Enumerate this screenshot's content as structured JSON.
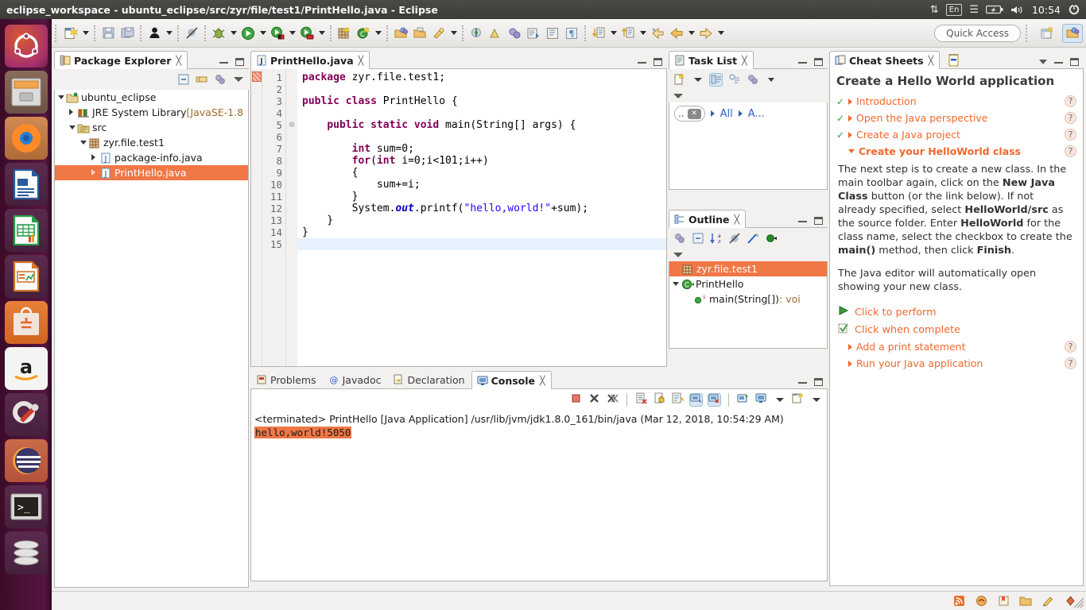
{
  "window": {
    "title": "eclipse_workspace - ubuntu_eclipse/src/zyr/file/test1/PrintHello.java - Eclipse"
  },
  "tray": {
    "network_icon": "network-updown-icon",
    "keyboard_layout": "En",
    "bluetooth_icon": "bluetooth-icon",
    "battery_icon": "battery-icon",
    "volume_icon": "volume-icon",
    "clock": "10:54",
    "session_icon": "session-gear-icon"
  },
  "launcher": {
    "items": [
      {
        "name": "ubuntu-dash",
        "glyph": "●",
        "cls": "ic-ubuntu",
        "active": false,
        "focus": false
      },
      {
        "name": "files",
        "glyph": "▤",
        "cls": "ic-files",
        "active": true,
        "focus": false
      },
      {
        "name": "firefox",
        "glyph": "●",
        "cls": "ic-firefox",
        "active": true,
        "focus": false
      },
      {
        "name": "libreoffice-writer",
        "glyph": "☰",
        "cls": "ic-writer",
        "active": false,
        "focus": false
      },
      {
        "name": "libreoffice-calc",
        "glyph": "⊞",
        "cls": "ic-calc",
        "active": false,
        "focus": false
      },
      {
        "name": "libreoffice-impress",
        "glyph": "▦",
        "cls": "ic-impress",
        "active": false,
        "focus": false
      },
      {
        "name": "ubuntu-software",
        "glyph": "A",
        "cls": "ic-software",
        "active": false,
        "focus": false
      },
      {
        "name": "amazon",
        "glyph": "a",
        "cls": "ic-amazon",
        "active": false,
        "focus": false
      },
      {
        "name": "system-settings",
        "glyph": "⚙",
        "cls": "ic-settings",
        "active": false,
        "focus": false
      },
      {
        "name": "eclipse",
        "glyph": "◐",
        "cls": "ic-eclipse",
        "active": true,
        "focus": true
      },
      {
        "name": "terminal",
        "glyph": "▶_",
        "cls": "ic-terminal",
        "active": false,
        "focus": false
      },
      {
        "name": "trash",
        "glyph": "□",
        "cls": "ic-trash",
        "active": false,
        "focus": false
      }
    ]
  },
  "toolbar": {
    "quick_access_placeholder": "Quick Access",
    "items": [
      {
        "name": "new-wizard-button",
        "glyph": "new",
        "arrow": true
      },
      {
        "sep": true
      },
      {
        "name": "save-button",
        "glyph": "save",
        "arrow": false
      },
      {
        "name": "save-all-button",
        "glyph": "saveall",
        "arrow": false
      },
      {
        "sep": true
      },
      {
        "name": "toggle-user-button",
        "glyph": "user",
        "arrow": true
      },
      {
        "sep": true
      },
      {
        "name": "skip-breakpoints-button",
        "glyph": "skipbp",
        "arrow": false
      },
      {
        "sep": true
      },
      {
        "name": "debug-button",
        "glyph": "debug",
        "arrow": true
      },
      {
        "name": "run-button",
        "glyph": "run",
        "arrow": true
      },
      {
        "name": "coverage-button",
        "glyph": "coverage",
        "arrow": true
      },
      {
        "name": "run-external-tools-button",
        "glyph": "externaltools",
        "arrow": true
      },
      {
        "sep": true
      },
      {
        "name": "new-java-package-button",
        "glyph": "newpackage",
        "arrow": false
      },
      {
        "name": "new-java-class-button",
        "glyph": "newclass",
        "arrow": true
      },
      {
        "sep": true
      },
      {
        "name": "open-type-button",
        "glyph": "opentype",
        "arrow": false
      },
      {
        "name": "open-task-button",
        "glyph": "opentask",
        "arrow": false
      },
      {
        "name": "search-button",
        "glyph": "search",
        "arrow": false
      },
      {
        "name": "annotation-button",
        "glyph": "annotation",
        "arrow": true
      },
      {
        "sep": true
      },
      {
        "name": "new-task-button",
        "glyph": "newtask",
        "arrow": false
      },
      {
        "name": "mark-done-button",
        "glyph": "markdone",
        "arrow": false
      },
      {
        "name": "activate-task-button",
        "glyph": "activatetask",
        "arrow": false
      },
      {
        "name": "previous-edit-button",
        "glyph": "prevedit",
        "arrow": false
      },
      {
        "name": "show-whitespace-button",
        "glyph": "whitespace",
        "arrow": false
      },
      {
        "sep": true
      },
      {
        "name": "next-annotation-button",
        "glyph": "nextanno",
        "arrow": true
      },
      {
        "name": "previous-annotation-button",
        "glyph": "prevanno",
        "arrow": true
      },
      {
        "name": "last-edit-location-button",
        "glyph": "lastedit",
        "arrow": false
      },
      {
        "name": "back-button",
        "glyph": "back",
        "arrow": true
      },
      {
        "name": "forward-button",
        "glyph": "forward",
        "arrow": true
      }
    ],
    "perspective_new": "open-perspective-button",
    "perspective_java": "java-perspective-button"
  },
  "package_explorer": {
    "tab_label": "Package Explorer",
    "tab_icon": "package-explorer-icon",
    "toolbar": [
      {
        "name": "collapse-all-button",
        "icon": "collapse-all-icon"
      },
      {
        "name": "link-with-editor-button",
        "icon": "link-editor-icon"
      },
      {
        "name": "view-menu-filters-button",
        "icon": "filters-icon"
      },
      {
        "name": "view-menu-button",
        "icon": "chevron-down-icon"
      }
    ],
    "tree": [
      {
        "label": "ubuntu_eclipse",
        "indent": 0,
        "twisty": "down",
        "icon": "java-project-icon",
        "selected": false,
        "suffix": ""
      },
      {
        "label": "JRE System Library ",
        "indent": 1,
        "twisty": "right",
        "icon": "library-icon",
        "selected": false,
        "suffix": "[JavaSE-1.8"
      },
      {
        "label": "src",
        "indent": 1,
        "twisty": "down",
        "icon": "source-folder-icon",
        "selected": false,
        "suffix": ""
      },
      {
        "label": "zyr.file.test1",
        "indent": 2,
        "twisty": "down",
        "icon": "package-icon",
        "selected": false,
        "suffix": ""
      },
      {
        "label": "package-info.java",
        "indent": 3,
        "twisty": "right",
        "icon": "java-file-icon",
        "selected": false,
        "suffix": ""
      },
      {
        "label": "PrintHello.java",
        "indent": 3,
        "twisty": "right",
        "icon": "java-file-icon",
        "selected": true,
        "suffix": ""
      }
    ]
  },
  "editor": {
    "tab_label": "PrintHello.java",
    "tab_icon": "java-file-icon",
    "close_glyph": "⌧",
    "lines": [
      {
        "n": 1,
        "fold": "",
        "current": false,
        "html": "<span class=\"kw\">package</span> zyr.file.test1;"
      },
      {
        "n": 2,
        "fold": "",
        "current": false,
        "html": ""
      },
      {
        "n": 3,
        "fold": "",
        "current": false,
        "html": "<span class=\"kw\">public class</span> PrintHello {"
      },
      {
        "n": 4,
        "fold": "",
        "current": false,
        "html": ""
      },
      {
        "n": 5,
        "fold": "⊝",
        "current": false,
        "html": "    <span class=\"kw\">public static void</span> main(String[] args) {"
      },
      {
        "n": 6,
        "fold": "",
        "current": false,
        "html": ""
      },
      {
        "n": 7,
        "fold": "",
        "current": false,
        "html": "        <span class=\"kw\">int</span> sum=0;"
      },
      {
        "n": 8,
        "fold": "",
        "current": false,
        "html": "        <span class=\"kw\">for</span>(<span class=\"kw\">int</span> i=0;i&lt;101;i++)"
      },
      {
        "n": 9,
        "fold": "",
        "current": false,
        "html": "        {"
      },
      {
        "n": 10,
        "fold": "",
        "current": false,
        "html": "            sum+=i;"
      },
      {
        "n": 11,
        "fold": "",
        "current": false,
        "html": "        }"
      },
      {
        "n": 12,
        "fold": "",
        "current": false,
        "html": "        System.<span class=\"fld\">out</span>.printf(<span class=\"str\">\"hello,world!\"</span>+sum);"
      },
      {
        "n": 13,
        "fold": "",
        "current": false,
        "html": "    }"
      },
      {
        "n": 14,
        "fold": "",
        "current": false,
        "html": "}"
      },
      {
        "n": 15,
        "fold": "",
        "current": true,
        "html": ""
      }
    ]
  },
  "task_list": {
    "tab_label": "Task List",
    "tab_icon": "task-list-icon",
    "toolbar": [
      {
        "name": "new-task-button",
        "icon": "new-task-icon"
      },
      {
        "name": "new-task-dropdown",
        "icon": "chevron-down-icon"
      },
      {
        "name": "categorized-presentation-button",
        "icon": "categorized-icon"
      },
      {
        "name": "scheduled-presentation-button",
        "icon": "scheduled-icon"
      },
      {
        "name": "focus-on-workweek-button",
        "icon": "filters-icon"
      },
      {
        "name": "view-menu-button",
        "icon": "chevron-down-icon"
      }
    ],
    "filter_placeholder": "..",
    "filter_clear_icon": "clear-icon",
    "breadcrumbs": [
      "All",
      "A..."
    ]
  },
  "outline": {
    "tab_label": "Outline",
    "tab_icon": "outline-icon",
    "toolbar": [
      {
        "name": "focus-on-active-task-button",
        "icon": "filters-icon"
      },
      {
        "name": "collapse-all-button",
        "icon": "collapse-all-icon"
      },
      {
        "name": "sort-button",
        "icon": "sort-az-icon"
      },
      {
        "name": "hide-fields-button",
        "icon": "hide-fields-icon"
      },
      {
        "name": "hide-static-button",
        "icon": "hide-static-icon"
      },
      {
        "name": "hide-nonpublic-button",
        "icon": "hide-nonpublic-icon"
      },
      {
        "name": "view-menu-button",
        "icon": "chevron-down-icon"
      }
    ],
    "tree": [
      {
        "label": "zyr.file.test1",
        "indent": 0,
        "twisty": "",
        "icon": "package-icon",
        "selected": true,
        "suffix": ""
      },
      {
        "label": "PrintHello",
        "indent": 0,
        "twisty": "down",
        "icon": "class-icon",
        "selected": false,
        "suffix": ""
      },
      {
        "label": "main(String[])",
        "indent": 1,
        "twisty": "",
        "icon": "method-public-static-icon",
        "selected": false,
        "suffix": " : voi"
      }
    ]
  },
  "console": {
    "tabs": [
      {
        "label": "Problems",
        "icon": "problems-icon",
        "selected": false
      },
      {
        "label": "Javadoc",
        "icon": "javadoc-icon",
        "selected": false
      },
      {
        "label": "Declaration",
        "icon": "declaration-icon",
        "selected": false
      },
      {
        "label": "Console",
        "icon": "console-icon",
        "selected": true
      }
    ],
    "close_glyph": "⌧",
    "toolbar": [
      {
        "name": "terminate-button",
        "icon": "terminate-icon"
      },
      {
        "name": "remove-launch-button",
        "icon": "remove-launch-icon"
      },
      {
        "name": "remove-all-terminated-button",
        "icon": "remove-all-icon"
      },
      {
        "sep": true
      },
      {
        "name": "clear-console-button",
        "icon": "clear-console-icon"
      },
      {
        "name": "scroll-lock-button",
        "icon": "scroll-lock-icon"
      },
      {
        "name": "word-wrap-button",
        "icon": "word-wrap-icon"
      },
      {
        "name": "show-console-on-output-button",
        "icon": "show-console-out-icon"
      },
      {
        "name": "show-console-on-error-button",
        "icon": "show-console-err-icon"
      },
      {
        "sep": true
      },
      {
        "name": "pin-console-button",
        "icon": "pin-console-icon"
      },
      {
        "name": "display-selected-console-button",
        "icon": "display-console-icon"
      },
      {
        "name": "display-selected-console-dropdown",
        "icon": "chevron-down-icon"
      },
      {
        "name": "open-console-button",
        "icon": "open-console-icon"
      },
      {
        "name": "open-console-dropdown",
        "icon": "chevron-down-icon"
      }
    ],
    "line1": "<terminated> PrintHello [Java Application] /usr/lib/jvm/jdk1.8.0_161/bin/java (Mar 12, 2018, 10:54:29 AM)",
    "line2": "hello,world!5050"
  },
  "cheat_sheets": {
    "tab_label": "Cheat Sheets",
    "tab_icon": "cheat-sheets-icon",
    "toolbar": [
      {
        "name": "collapse-all-but-current-button",
        "icon": "cheat-sheet-menu-icon"
      },
      {
        "name": "view-menu-button",
        "icon": "chevron-down-icon"
      }
    ],
    "title": "Create a Hello World application",
    "steps": [
      {
        "label": "Introduction",
        "done": true,
        "expanded": false,
        "bold": false,
        "help": "?"
      },
      {
        "label": "Open the Java perspective",
        "done": true,
        "expanded": false,
        "bold": false,
        "help": "?"
      },
      {
        "label": "Create a Java project",
        "done": true,
        "expanded": false,
        "bold": false,
        "help": "?"
      },
      {
        "label": "Create your HelloWorld class",
        "done": false,
        "expanded": true,
        "bold": true,
        "help": "?"
      }
    ],
    "body_html": "<p>The next step is to create a new class. In the main toolbar again, click on the <b>New Java Class</b> button (or the link below). If not already specified, select <b>HelloWorld/src</b> as the source folder. Enter <b>HelloWorld</b> for the class name, select the checkbox to create the <b>main()</b> method, then click <b>Finish</b>.</p><p>The Java editor will automatically open showing your new class.</p>",
    "actions": [
      {
        "label": "Click to perform",
        "icon": "play-icon"
      },
      {
        "label": "Click when complete",
        "icon": "checklist-icon"
      }
    ],
    "steps_after": [
      {
        "label": "Add a print statement",
        "done": false,
        "expanded": false,
        "bold": false,
        "help": "?"
      },
      {
        "label": "Run your Java application",
        "done": false,
        "expanded": false,
        "bold": false,
        "help": "?"
      }
    ]
  },
  "status_bar": {
    "items": [
      {
        "name": "feed-icon",
        "glyph": "◴"
      },
      {
        "name": "mylyn-icon",
        "glyph": "◑"
      },
      {
        "name": "bookmark-icon",
        "glyph": "▢"
      },
      {
        "name": "folder-icon",
        "glyph": "▱"
      },
      {
        "name": "edit-icon",
        "glyph": "✐"
      },
      {
        "name": "connection-icon",
        "glyph": "◈"
      }
    ]
  },
  "colors": {
    "accent_orange": "#f07746",
    "cheat_link": "#f0682c",
    "keyword_purple": "#7f0055",
    "string_blue": "#2a00ff",
    "selection_bg": "#f07746"
  }
}
